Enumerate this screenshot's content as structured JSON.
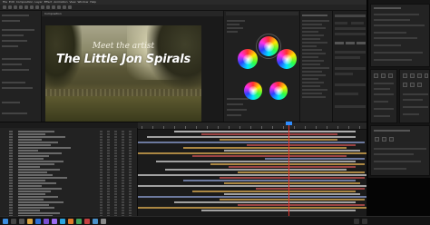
{
  "app": {
    "title_bar": "Adobe After Effects CC 2017",
    "menu": [
      "File",
      "Edit",
      "Composition",
      "Layer",
      "Effect",
      "Animation",
      "View",
      "Window",
      "Help"
    ]
  },
  "composition": {
    "tab_label": "Composition",
    "overlay_small": "Meet the artist",
    "overlay_big": "The Little Jon Spirals"
  },
  "color_panel": {
    "tab_label": "Lumetri Color",
    "wheels": [
      "Shadows",
      "Midtones",
      "Highlights"
    ],
    "accent": "#ff3030"
  },
  "timeline": {
    "tab_label": "Timeline",
    "playhead_color": "#e0342c",
    "cti_color": "#2f8dff",
    "clip_colors": [
      "#c8c8c8",
      "#b24a4a",
      "#c49a4a",
      "#7a8ab5",
      "#b8b8b8"
    ]
  },
  "taskbar": {
    "clock_time": "",
    "clock_date": ""
  }
}
